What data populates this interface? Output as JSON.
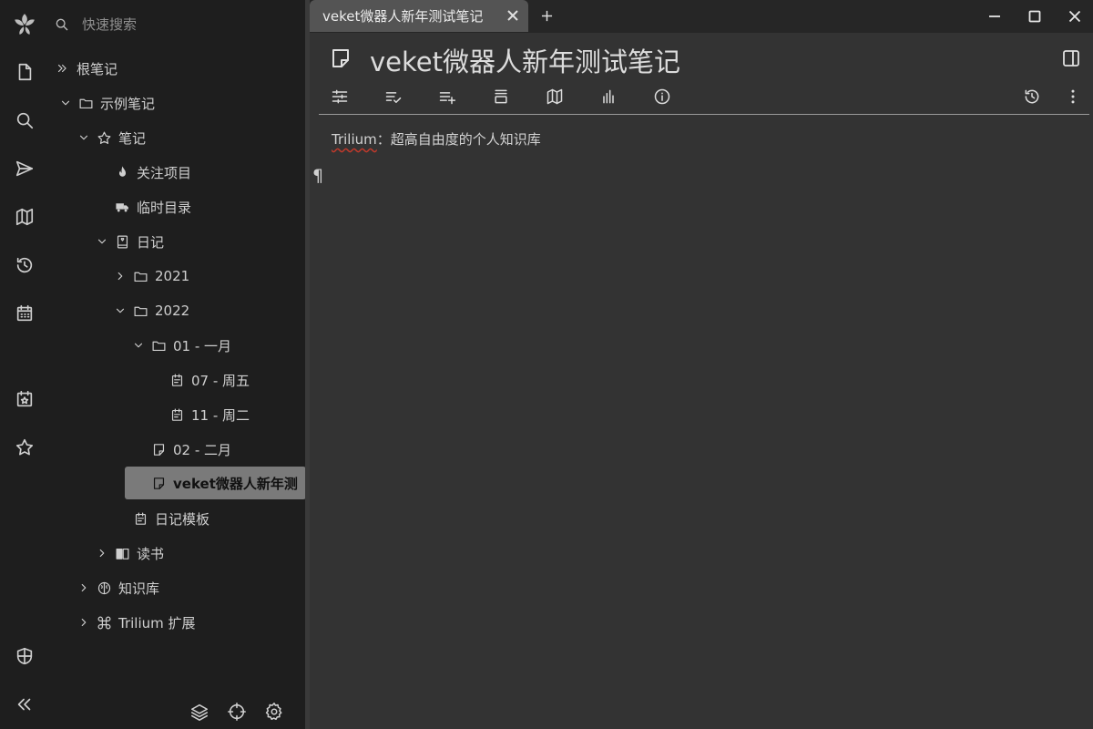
{
  "launcher": {
    "items": [
      {
        "name": "logo-icon"
      },
      {
        "name": "new-note-icon"
      },
      {
        "name": "search-icon"
      },
      {
        "name": "jump-to-note-icon"
      },
      {
        "name": "note-map-icon"
      },
      {
        "name": "recent-changes-icon"
      },
      {
        "name": "calendar-icon"
      },
      {
        "name": "today-note-icon"
      },
      {
        "name": "bookmark-star-icon"
      },
      {
        "name": "protected-session-icon"
      },
      {
        "name": "collapse-sidebar-icon"
      }
    ]
  },
  "search": {
    "placeholder": "快速搜索"
  },
  "tree": {
    "nodes": [
      {
        "label": "根笔记",
        "icon": "double-chevron-icon"
      },
      {
        "label": "示例笔记",
        "icon": "folder-icon"
      },
      {
        "label": "笔记",
        "icon": "star-icon"
      },
      {
        "label": "关注项目",
        "icon": "fire-icon"
      },
      {
        "label": "临时目录",
        "icon": "truck-icon"
      },
      {
        "label": "日记",
        "icon": "journal-icon"
      },
      {
        "label": "2021",
        "icon": "folder-icon"
      },
      {
        "label": "2022",
        "icon": "folder-icon"
      },
      {
        "label": "01 - 一月",
        "icon": "folder-icon"
      },
      {
        "label": "07 - 周五",
        "icon": "calendar-note-icon"
      },
      {
        "label": "11 - 周二",
        "icon": "calendar-note-icon"
      },
      {
        "label": "02 - 二月",
        "icon": "note-icon"
      },
      {
        "label": "veket微器人新年测",
        "icon": "note-icon",
        "active": true
      },
      {
        "label": "日记模板",
        "icon": "calendar-note-icon"
      },
      {
        "label": "读书",
        "icon": "book-icon"
      },
      {
        "label": "知识库",
        "icon": "brain-icon"
      },
      {
        "label": "Trilium 扩展",
        "icon": "command-icon"
      }
    ]
  },
  "tab": {
    "title": "veket微器人新年测试笔记"
  },
  "note": {
    "title": "veket微器人新年测试笔记",
    "content_word": "Trilium",
    "content_rest": "：超高自由度的个人知识库",
    "pilcrow": "¶"
  },
  "colors": {
    "background": "#1e1e1e",
    "main_background": "#333333",
    "active_node": "#7a7a7a",
    "tab_active": "#545454",
    "text": "#cfcfcf"
  }
}
